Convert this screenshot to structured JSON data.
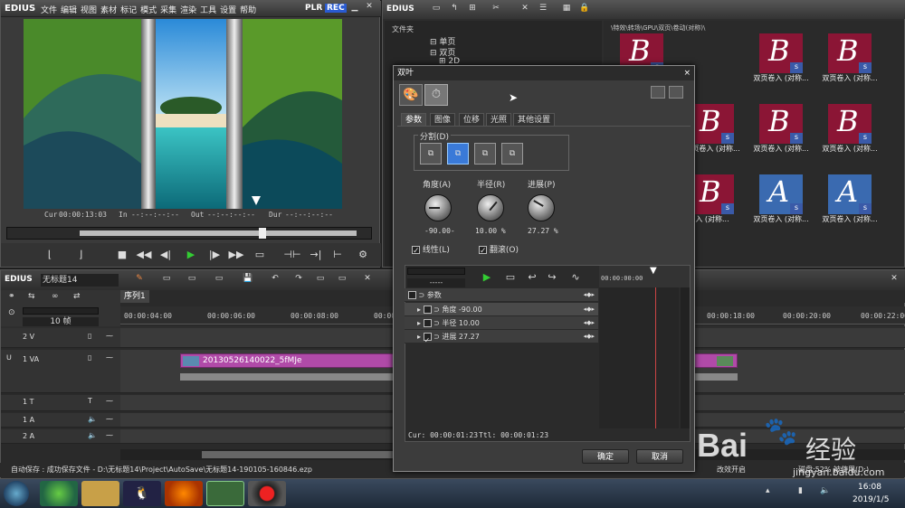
{
  "player": {
    "app": "EDIUS",
    "menu": [
      "文件",
      "编辑",
      "视图",
      "素材",
      "标记",
      "模式",
      "采集",
      "渲染",
      "工具",
      "设置",
      "帮助"
    ],
    "mode": "PLR",
    "mode_rec": "REC",
    "cur_label": "Cur",
    "cur": "00:00:13:03",
    "in_label": "In",
    "in": "--:--:--:--",
    "out_label": "Out",
    "out": "--:--:--:--",
    "dur_label": "Dur",
    "dur": "--:--:--:--"
  },
  "bin": {
    "app": "EDIUS",
    "folder_header": "文件夹",
    "folders": [
      "单页",
      "双页",
      "2D"
    ],
    "path": "\\特效\\转场\\GPU\\双页\\卷动(对称)\\",
    "thumbs": [
      {
        "caption": ""
      },
      {
        "caption": "双页卷入 (对称..."
      },
      {
        "caption": "双页卷入 (对称..."
      },
      {
        "caption": "双页卷入 (对称..."
      },
      {
        "caption": "双页卷入 (对称..."
      },
      {
        "caption": "双页卷入 (对称..."
      },
      {
        "caption": "入 (对称..."
      },
      {
        "caption": "双页卷入 (对称..."
      },
      {
        "caption": "双页卷入 (对称..."
      }
    ]
  },
  "timeline": {
    "app": "EDIUS",
    "project": "无标题14",
    "sequence_tab": "序列1",
    "zoom": "10 帧",
    "ruler": [
      "00:00:04:00",
      "00:00:06:00",
      "00:00:08:00",
      "00:00:1",
      "00:00:18:00",
      "00:00:20:00",
      "00:00:22:00"
    ],
    "tracks": [
      {
        "name": "2 V"
      },
      {
        "name": "1 VA"
      },
      {
        "name": "1 T"
      },
      {
        "name": "1 A"
      },
      {
        "name": "2 A"
      }
    ],
    "clip_name": "20130526140022_5fMJe"
  },
  "status": {
    "text": "自动保存 : 成功保存文件 - D:\\无标题14\\Project\\AutoSave\\无标题14-190105-160846.ezp",
    "right_1": "改效开启",
    "right_2": "磁盘:52% 被使用(D:)"
  },
  "taskbar": {
    "time": "16:08",
    "date": "2019/1/5"
  },
  "dialog": {
    "title": "双叶",
    "close": "×",
    "tabs": [
      "参数",
      "图像",
      "位移",
      "光照",
      "其他设置"
    ],
    "group_split": "分割(D)",
    "angle_label": "角度(A)",
    "angle_value": "-90.00-",
    "radius_label": "半径(R)",
    "radius_value": "10.00 %",
    "progress_label": "进展(P)",
    "progress_value": "27.27 %",
    "linear_label": "线性(L)",
    "flip_label": "翻滚(O)",
    "kf_menu": "-----",
    "kf_ruler": "00:00:00:00",
    "kf_rows": [
      {
        "name": "参数",
        "value": ""
      },
      {
        "name": "角度",
        "value": "-90.00"
      },
      {
        "name": "半径",
        "value": "10.00"
      },
      {
        "name": "进展",
        "value": "27.27"
      }
    ],
    "cur": "Cur: 00:00:01:23",
    "ttl": "Ttl: 00:00:01:23",
    "ok": "确定",
    "cancel": "取消"
  },
  "watermark": {
    "brand": "Bai",
    "brand2": "经验",
    "url": "jingyan.baidu.com"
  }
}
